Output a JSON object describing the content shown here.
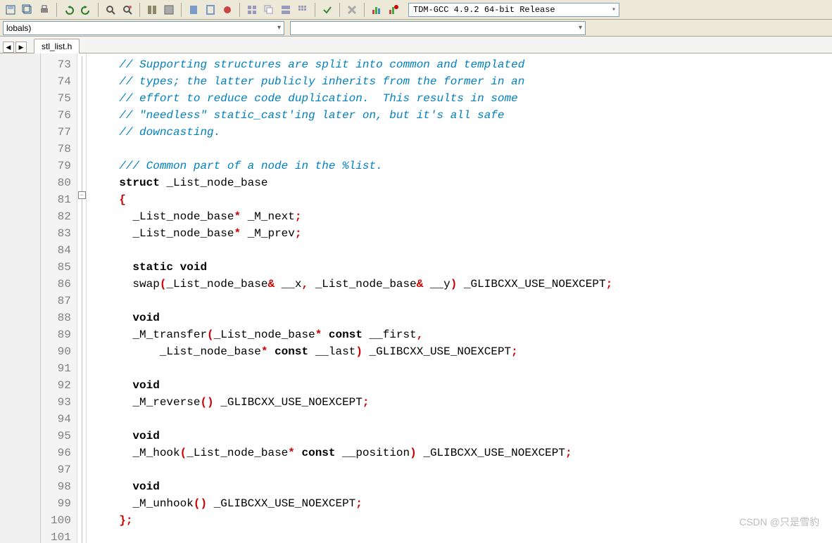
{
  "toolbar": {
    "compiler_label": "TDM-GCC 4.9.2 64-bit Release"
  },
  "combos": {
    "scope_label": "lobals)",
    "member_label": ""
  },
  "tabnav": {
    "prev": "◀",
    "next": "▶"
  },
  "tab": {
    "filename": "stl_list.h"
  },
  "gutter": {
    "lines": [
      "73",
      "74",
      "75",
      "76",
      "77",
      "78",
      "79",
      "80",
      "81",
      "82",
      "83",
      "84",
      "85",
      "86",
      "87",
      "88",
      "89",
      "90",
      "91",
      "92",
      "93",
      "94",
      "95",
      "96",
      "97",
      "98",
      "99",
      "100",
      "101"
    ]
  },
  "code": {
    "lines": [
      [
        [
          "cm",
          "    // Supporting structures are split into common and templated"
        ]
      ],
      [
        [
          "cm",
          "    // types; the latter publicly inherits from the former in an"
        ]
      ],
      [
        [
          "cm",
          "    // effort to reduce code duplication.  This results in some"
        ]
      ],
      [
        [
          "cm",
          "    // \"needless\" static_cast'ing later on, but it's all safe"
        ]
      ],
      [
        [
          "cm",
          "    // downcasting."
        ]
      ],
      [
        [
          "id",
          ""
        ]
      ],
      [
        [
          "cm",
          "    /// Common part of a node in the %list."
        ]
      ],
      [
        [
          "id",
          "    "
        ],
        [
          "kw",
          "struct"
        ],
        [
          "id",
          " _List_node_base"
        ]
      ],
      [
        [
          "id",
          "    "
        ],
        [
          "pu",
          "{"
        ]
      ],
      [
        [
          "id",
          "      _List_node_base"
        ],
        [
          "op",
          "*"
        ],
        [
          "id",
          " _M_next"
        ],
        [
          "pu",
          ";"
        ]
      ],
      [
        [
          "id",
          "      _List_node_base"
        ],
        [
          "op",
          "*"
        ],
        [
          "id",
          " _M_prev"
        ],
        [
          "pu",
          ";"
        ]
      ],
      [
        [
          "id",
          ""
        ]
      ],
      [
        [
          "id",
          "      "
        ],
        [
          "kw",
          "static void"
        ]
      ],
      [
        [
          "id",
          "      swap"
        ],
        [
          "pu",
          "("
        ],
        [
          "id",
          "_List_node_base"
        ],
        [
          "op",
          "&"
        ],
        [
          "id",
          " __x"
        ],
        [
          "pu",
          ","
        ],
        [
          "id",
          " _List_node_base"
        ],
        [
          "op",
          "&"
        ],
        [
          "id",
          " __y"
        ],
        [
          "pu",
          ")"
        ],
        [
          "id",
          " _GLIBCXX_USE_NOEXCEPT"
        ],
        [
          "pu",
          ";"
        ]
      ],
      [
        [
          "id",
          ""
        ]
      ],
      [
        [
          "id",
          "      "
        ],
        [
          "kw",
          "void"
        ]
      ],
      [
        [
          "id",
          "      _M_transfer"
        ],
        [
          "pu",
          "("
        ],
        [
          "id",
          "_List_node_base"
        ],
        [
          "op",
          "*"
        ],
        [
          "id",
          " "
        ],
        [
          "kw",
          "const"
        ],
        [
          "id",
          " __first"
        ],
        [
          "pu",
          ","
        ]
      ],
      [
        [
          "id",
          "          _List_node_base"
        ],
        [
          "op",
          "*"
        ],
        [
          "id",
          " "
        ],
        [
          "kw",
          "const"
        ],
        [
          "id",
          " __last"
        ],
        [
          "pu",
          ")"
        ],
        [
          "id",
          " _GLIBCXX_USE_NOEXCEPT"
        ],
        [
          "pu",
          ";"
        ]
      ],
      [
        [
          "id",
          ""
        ]
      ],
      [
        [
          "id",
          "      "
        ],
        [
          "kw",
          "void"
        ]
      ],
      [
        [
          "id",
          "      _M_reverse"
        ],
        [
          "pu",
          "()"
        ],
        [
          "id",
          " _GLIBCXX_USE_NOEXCEPT"
        ],
        [
          "pu",
          ";"
        ]
      ],
      [
        [
          "id",
          ""
        ]
      ],
      [
        [
          "id",
          "      "
        ],
        [
          "kw",
          "void"
        ]
      ],
      [
        [
          "id",
          "      _M_hook"
        ],
        [
          "pu",
          "("
        ],
        [
          "id",
          "_List_node_base"
        ],
        [
          "op",
          "*"
        ],
        [
          "id",
          " "
        ],
        [
          "kw",
          "const"
        ],
        [
          "id",
          " __position"
        ],
        [
          "pu",
          ")"
        ],
        [
          "id",
          " _GLIBCXX_USE_NOEXCEPT"
        ],
        [
          "pu",
          ";"
        ]
      ],
      [
        [
          "id",
          ""
        ]
      ],
      [
        [
          "id",
          "      "
        ],
        [
          "kw",
          "void"
        ]
      ],
      [
        [
          "id",
          "      _M_unhook"
        ],
        [
          "pu",
          "()"
        ],
        [
          "id",
          " _GLIBCXX_USE_NOEXCEPT"
        ],
        [
          "pu",
          ";"
        ]
      ],
      [
        [
          "id",
          "    "
        ],
        [
          "pu",
          "};"
        ]
      ],
      [
        [
          "id",
          ""
        ]
      ]
    ]
  },
  "watermark": "CSDN @只是雪豹"
}
